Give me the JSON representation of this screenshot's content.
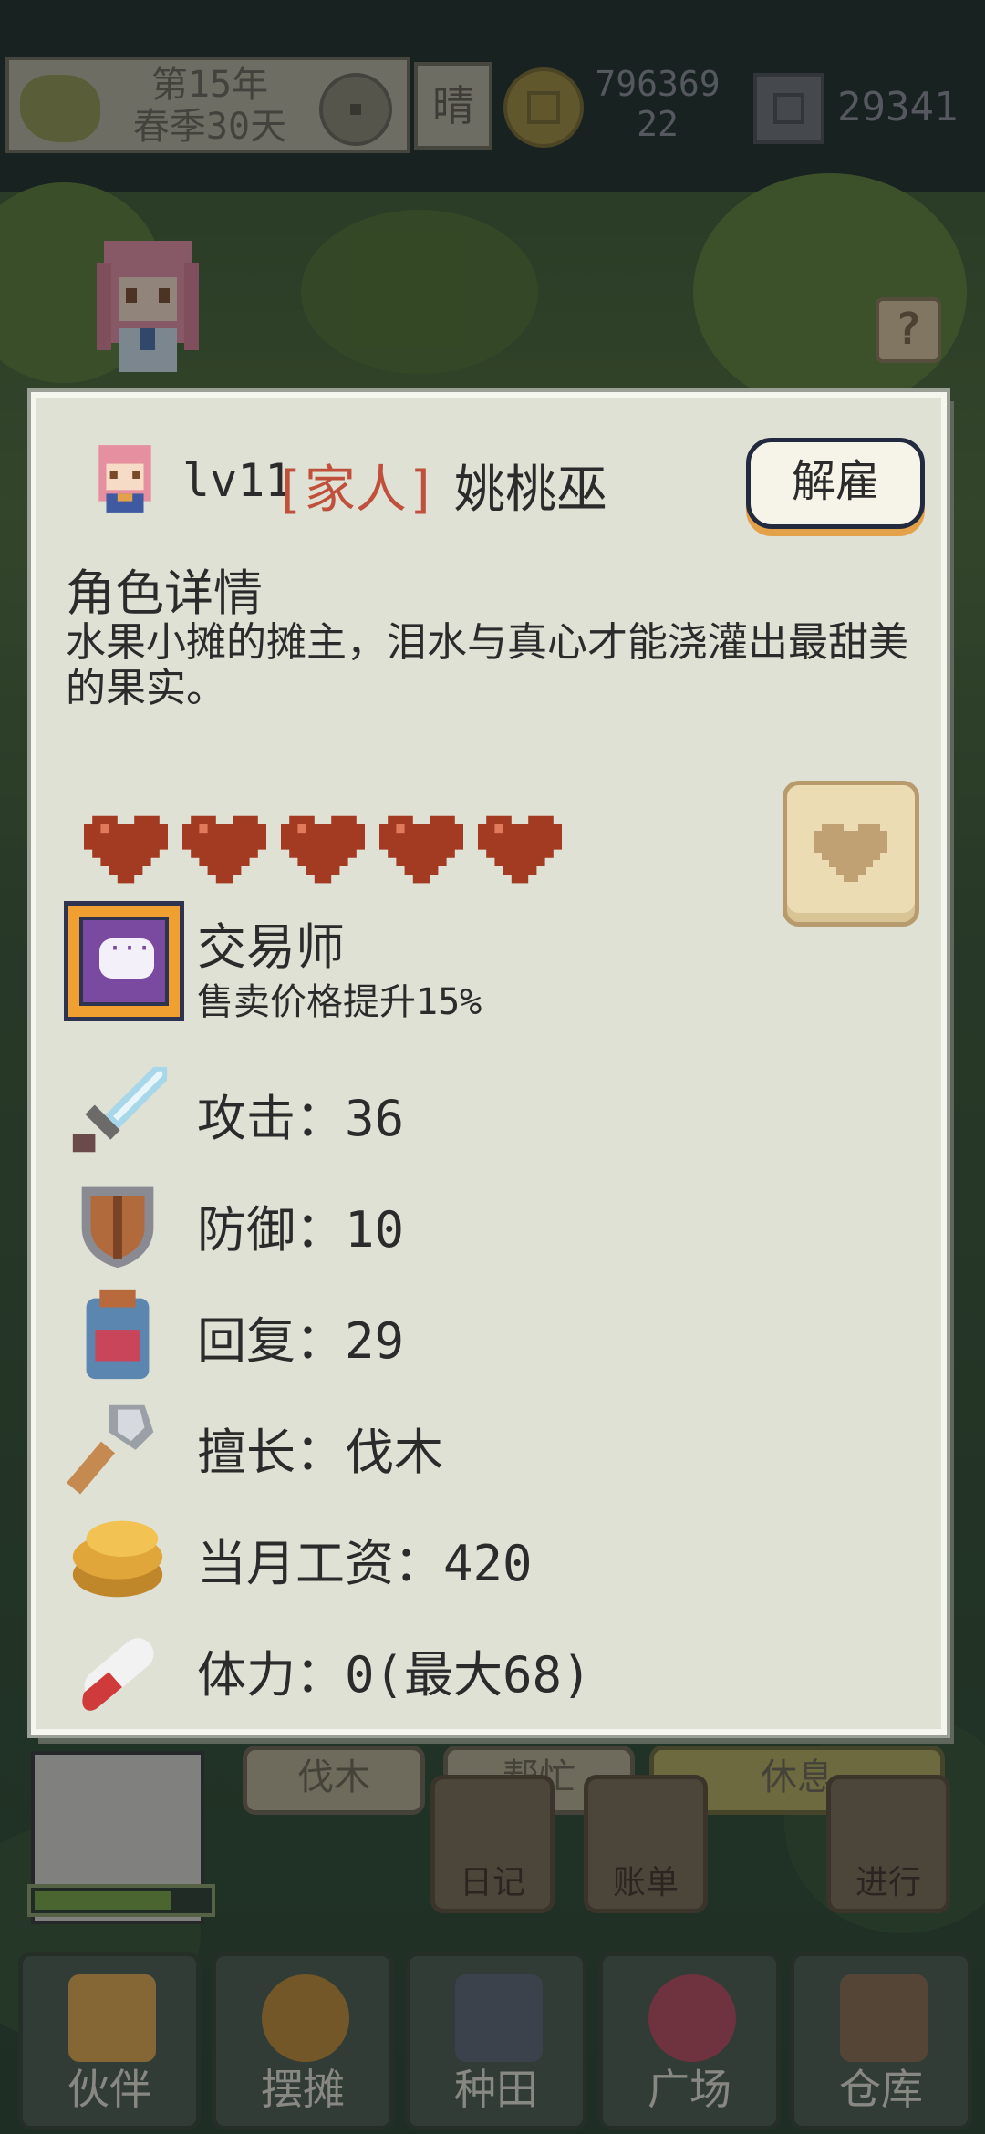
{
  "hud": {
    "date_line1": "第15年",
    "date_line2": "春季30天",
    "weather": "晴",
    "gold_line1": "796369",
    "gold_line2": "22",
    "gems": "29341"
  },
  "character": {
    "level": "lv11",
    "tag": "[家人]",
    "name": "姚桃巫",
    "fire_button": "解雇",
    "section_title": "角色详情",
    "description": "水果小摊的摊主，泪水与真心才能浇灌出最甜美的果实。",
    "hearts_filled": 5,
    "trait": {
      "name": "交易师",
      "description": "售卖价格提升15%"
    },
    "stats": {
      "attack": "攻击：36",
      "defense": "防御：10",
      "recovery": "回复：29",
      "specialty": "擅长：伐木",
      "salary": "当月工资：420",
      "stamina": "体力：0(最大68)"
    }
  },
  "help_label": "?",
  "background": {
    "action_buttons": [
      "伐木",
      "帮忙",
      "休息"
    ],
    "tiles": [
      "日记",
      "账单",
      "进行"
    ],
    "nav": [
      "伙伴",
      "摆摊",
      "种田",
      "广场",
      "仓库"
    ]
  },
  "colors": {
    "card_bg": "#dfe1d5",
    "tag_red": "#c0503c",
    "heart_red": "#a33a22"
  }
}
